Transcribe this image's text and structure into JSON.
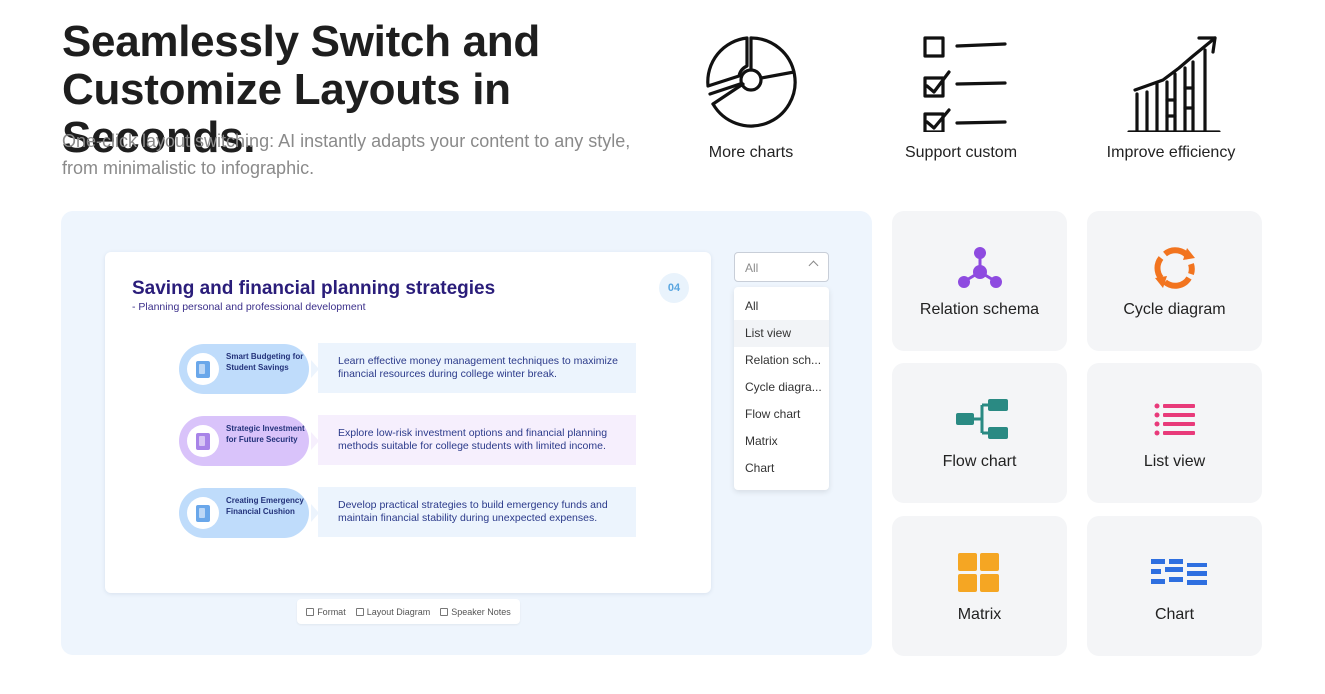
{
  "hero": {
    "title_line1": "Seamlessly Switch and",
    "title_line2": "Customize Layouts in Seconds.",
    "subtitle": "One-click layout switching: AI instantly adapts your content to any style, from minimalistic to infographic."
  },
  "features": [
    {
      "label": "More charts",
      "icon": "pie-chart-icon"
    },
    {
      "label": "Support custom",
      "icon": "checklist-icon"
    },
    {
      "label": "Improve efficiency",
      "icon": "growth-chart-icon"
    }
  ],
  "slide": {
    "title": "Saving and financial planning strategies",
    "subtitle": "- Planning personal and professional development",
    "page_number": "04",
    "rows": [
      {
        "pill": "Smart Budgeting for Student Savings",
        "desc": "Learn effective money management techniques to maximize financial resources during college winter break.",
        "pill_color": "#bfdcfb",
        "desc_color": "#ecf4fd",
        "book_color": "#6aa7ea"
      },
      {
        "pill": "Strategic Investment for Future Security",
        "desc": "Explore low-risk investment options and financial planning methods suitable for college students with limited income.",
        "pill_color": "#d9c3fa",
        "desc_color": "#f6effd",
        "book_color": "#a884e8"
      },
      {
        "pill": "Creating Emergency Financial Cushion",
        "desc": "Develop practical strategies to build emergency funds and maintain financial stability during unexpected expenses.",
        "pill_color": "#bfdcfb",
        "desc_color": "#ecf4fd",
        "book_color": "#6aa7ea"
      }
    ]
  },
  "toolbar": {
    "format": "Format",
    "layout_diagram": "Layout Diagram",
    "speaker_notes": "Speaker Notes"
  },
  "layout_select": {
    "value": "All",
    "options": [
      "All",
      "List view",
      "Relation sch...",
      "Cycle diagra...",
      "Flow chart",
      "Matrix",
      "Chart"
    ],
    "highlighted": "List view"
  },
  "layout_cards": [
    {
      "label": "Relation schema",
      "icon": "relation-schema-icon",
      "color": "#8e4be0"
    },
    {
      "label": "Cycle diagram",
      "icon": "cycle-diagram-icon",
      "color": "#f2741f"
    },
    {
      "label": "Flow chart",
      "icon": "flow-chart-icon",
      "color": "#2a8a83"
    },
    {
      "label": "List view",
      "icon": "list-view-icon",
      "color": "#e83a7a"
    },
    {
      "label": "Matrix",
      "icon": "matrix-icon",
      "color": "#f5a623"
    },
    {
      "label": "Chart",
      "icon": "chart-icon",
      "color": "#2e6fe0"
    }
  ]
}
